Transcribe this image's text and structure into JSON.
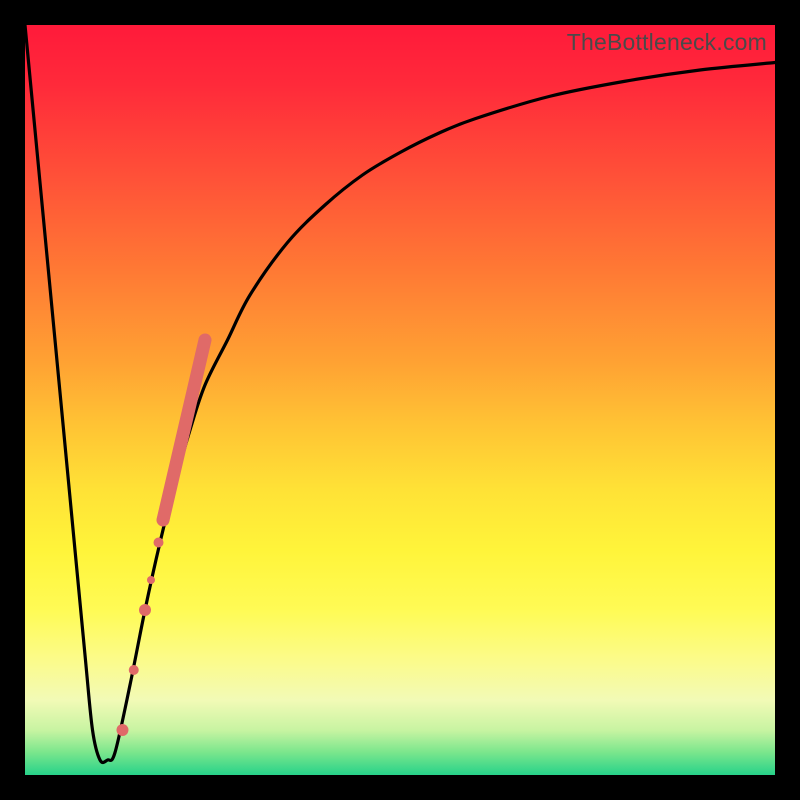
{
  "watermark": "TheBottleneck.com",
  "chart_data": {
    "type": "line",
    "title": "",
    "xlabel": "",
    "ylabel": "",
    "xlim": [
      0,
      100
    ],
    "ylim": [
      0,
      100
    ],
    "grid": false,
    "series": [
      {
        "name": "bottleneck-curve",
        "color": "#000000",
        "x": [
          0,
          2,
          4,
          6,
          8,
          9,
          10,
          11,
          12,
          14,
          16,
          18,
          20,
          22,
          24,
          27,
          30,
          35,
          40,
          45,
          50,
          55,
          60,
          70,
          80,
          90,
          100
        ],
        "y": [
          100,
          79,
          58,
          37,
          16,
          6,
          2,
          2,
          3,
          12,
          22,
          31,
          39,
          46,
          52,
          58,
          64,
          71,
          76,
          80,
          83,
          85.5,
          87.5,
          90.5,
          92.5,
          94,
          95
        ]
      },
      {
        "name": "highlight-band",
        "color": "#e06a68",
        "type": "scatter",
        "x": [
          13.0,
          14.5,
          16.0,
          16.8,
          17.8,
          20.0,
          23.5
        ],
        "y": [
          6,
          14,
          22,
          26,
          31,
          41,
          56
        ]
      }
    ],
    "highlight_segment": {
      "name": "highlight-thick",
      "color": "#e06a68",
      "x_start": 18.4,
      "y_start": 34,
      "x_end": 24.0,
      "y_end": 58
    }
  }
}
